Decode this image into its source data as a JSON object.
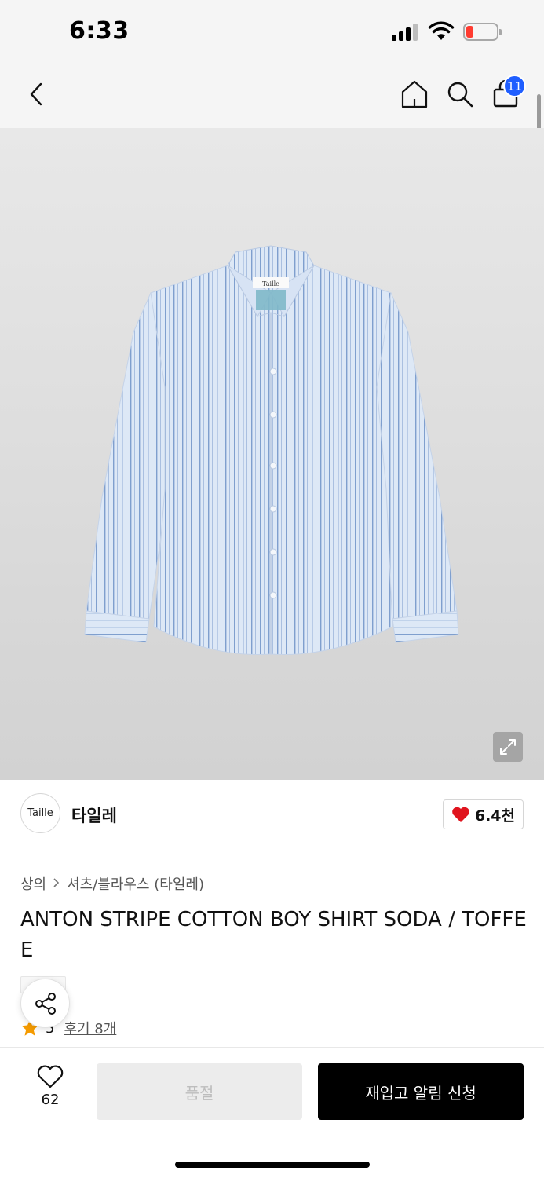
{
  "status_bar": {
    "time": "6:33",
    "battery_color": "#ff3b30"
  },
  "header": {
    "back_icon": "chevron-left-icon",
    "home_icon": "home-icon",
    "search_icon": "search-icon",
    "cart_icon": "shopping-bag-icon",
    "cart_count": "11",
    "badge_color": "#1f5eff"
  },
  "product_image": {
    "shirt_tag_label": "Taille",
    "expand_icon": "expand-icon"
  },
  "brand": {
    "logo_text": "Taille",
    "name": "타일레",
    "like_count": "6.4천",
    "like_icon": "heart-filled-icon",
    "like_color": "#e0141e"
  },
  "product": {
    "breadcrumb": [
      "상의",
      "셔츠/블라우스 (타일레)"
    ],
    "title": "ANTON STRIPE COTTON BOY SHIRT SODA / TOFFEE",
    "rating": "5",
    "review_link": "후기 8개",
    "star_color": "#f59b00"
  },
  "bottom_bar": {
    "wish_count": "62",
    "soldout_label": "품절",
    "restock_label": "재입고 알림 신청"
  }
}
